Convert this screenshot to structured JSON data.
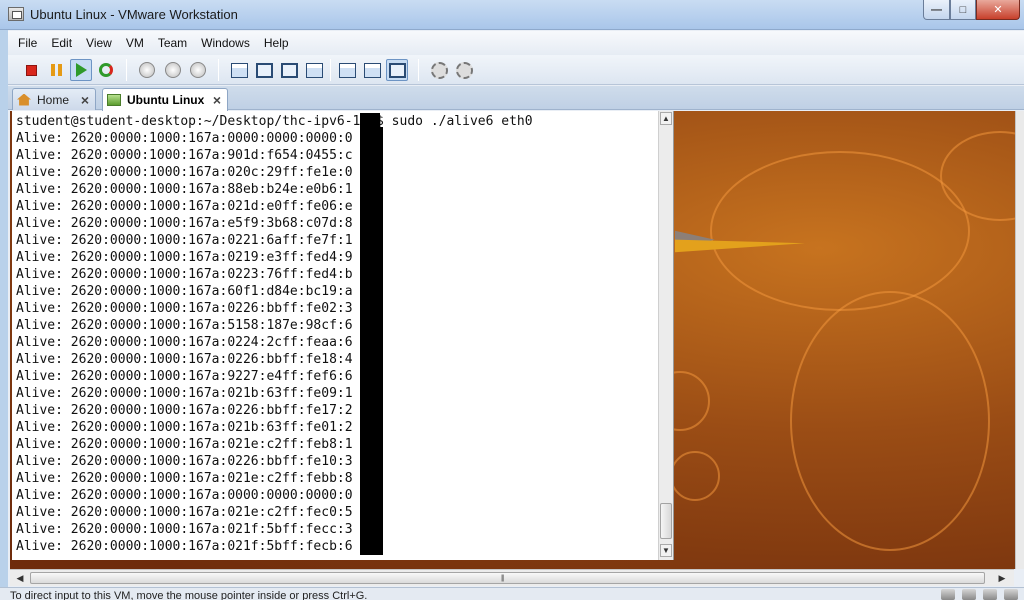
{
  "window": {
    "title": "Ubuntu Linux - VMware Workstation",
    "buttons": [
      "minimize",
      "maximize",
      "close"
    ]
  },
  "menu": [
    "File",
    "Edit",
    "View",
    "VM",
    "Team",
    "Windows",
    "Help"
  ],
  "toolbar": {
    "icons": [
      "stop-icon",
      "pause-icon",
      "play-icon",
      "reset-icon",
      "snapshot-icon",
      "revert-snapshot-icon",
      "snapshot-manager-icon",
      "normal-view-icon",
      "full-screen-icon",
      "quick-switch-icon",
      "unity-icon",
      "console-view-icon",
      "summary-view-icon",
      "appliance-view-icon",
      "vm-settings-icon",
      "network-settings-icon"
    ]
  },
  "tabs": [
    {
      "label": "Home",
      "icon": "home-icon"
    },
    {
      "label": "Ubuntu Linux",
      "icon": "vm-icon",
      "active": true
    }
  ],
  "terminal": {
    "prompt": "student@student-desktop:~/Desktop/thc-ipv6-1.1$ sudo ./alive6 eth0",
    "lines": [
      "Alive: 2620:0000:1000:167a:0000:0000:0000:0",
      "Alive: 2620:0000:1000:167a:901d:f654:0455:c",
      "Alive: 2620:0000:1000:167a:020c:29ff:fe1e:0",
      "Alive: 2620:0000:1000:167a:88eb:b24e:e0b6:1",
      "Alive: 2620:0000:1000:167a:021d:e0ff:fe06:e",
      "Alive: 2620:0000:1000:167a:e5f9:3b68:c07d:8",
      "Alive: 2620:0000:1000:167a:0221:6aff:fe7f:1",
      "Alive: 2620:0000:1000:167a:0219:e3ff:fed4:9",
      "Alive: 2620:0000:1000:167a:0223:76ff:fed4:b",
      "Alive: 2620:0000:1000:167a:60f1:d84e:bc19:a",
      "Alive: 2620:0000:1000:167a:0226:bbff:fe02:3",
      "Alive: 2620:0000:1000:167a:5158:187e:98cf:6",
      "Alive: 2620:0000:1000:167a:0224:2cff:feaa:6",
      "Alive: 2620:0000:1000:167a:0226:bbff:fe18:4",
      "Alive: 2620:0000:1000:167a:9227:e4ff:fef6:6",
      "Alive: 2620:0000:1000:167a:021b:63ff:fe09:1",
      "Alive: 2620:0000:1000:167a:0226:bbff:fe17:2",
      "Alive: 2620:0000:1000:167a:021b:63ff:fe01:2",
      "Alive: 2620:0000:1000:167a:021e:c2ff:feb8:1",
      "Alive: 2620:0000:1000:167a:0226:bbff:fe10:3",
      "Alive: 2620:0000:1000:167a:021e:c2ff:febb:8",
      "Alive: 2620:0000:1000:167a:0000:0000:0000:0",
      "Alive: 2620:0000:1000:167a:021e:c2ff:fec0:5",
      "Alive: 2620:0000:1000:167a:021f:5bff:fecc:3",
      "Alive: 2620:0000:1000:167a:021f:5bff:fecb:6"
    ]
  },
  "status": {
    "message": "To direct input to this VM, move the mouse pointer inside or press Ctrl+G."
  },
  "colors": {
    "terminal_bg": "#ffffff",
    "desktop_bg": "#9b4d15",
    "titlebar": "#b9d1ea"
  }
}
